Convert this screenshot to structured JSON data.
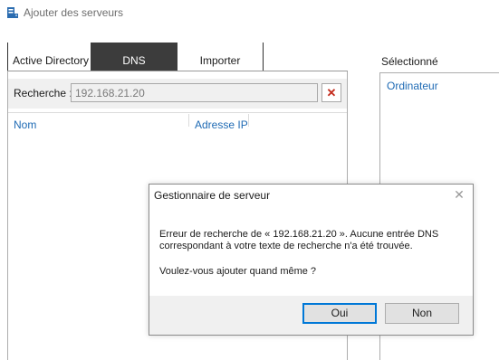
{
  "window": {
    "title": "Ajouter des serveurs",
    "icon": "server-add-icon"
  },
  "tabs": [
    {
      "label": "Active Directory",
      "active": false
    },
    {
      "label": "DNS",
      "active": true
    },
    {
      "label": "Importer",
      "active": false
    }
  ],
  "search": {
    "label": "Recherche :",
    "value": "192.168.21.20",
    "clear_icon": "close-x-icon"
  },
  "results_table": {
    "columns": [
      "Nom",
      "Adresse IP"
    ]
  },
  "selected_panel": {
    "label": "Sélectionné",
    "columns": [
      "Ordinateur"
    ]
  },
  "dialog": {
    "title": "Gestionnaire de serveur",
    "close_glyph": "✕",
    "message_line1": "Erreur de recherche de « 192.168.21.20 ». Aucune entrée DNS",
    "message_line2": "correspondant à votre texte de recherche n'a été trouvée.",
    "question": "Voulez-vous ajouter quand même ?",
    "buttons": {
      "yes": "Oui",
      "no": "Non"
    }
  },
  "colors": {
    "accent": "#0078d7",
    "link": "#1e6ab4",
    "active_tab_bg": "#3c3c3c",
    "clear_red": "#c42b1c"
  }
}
